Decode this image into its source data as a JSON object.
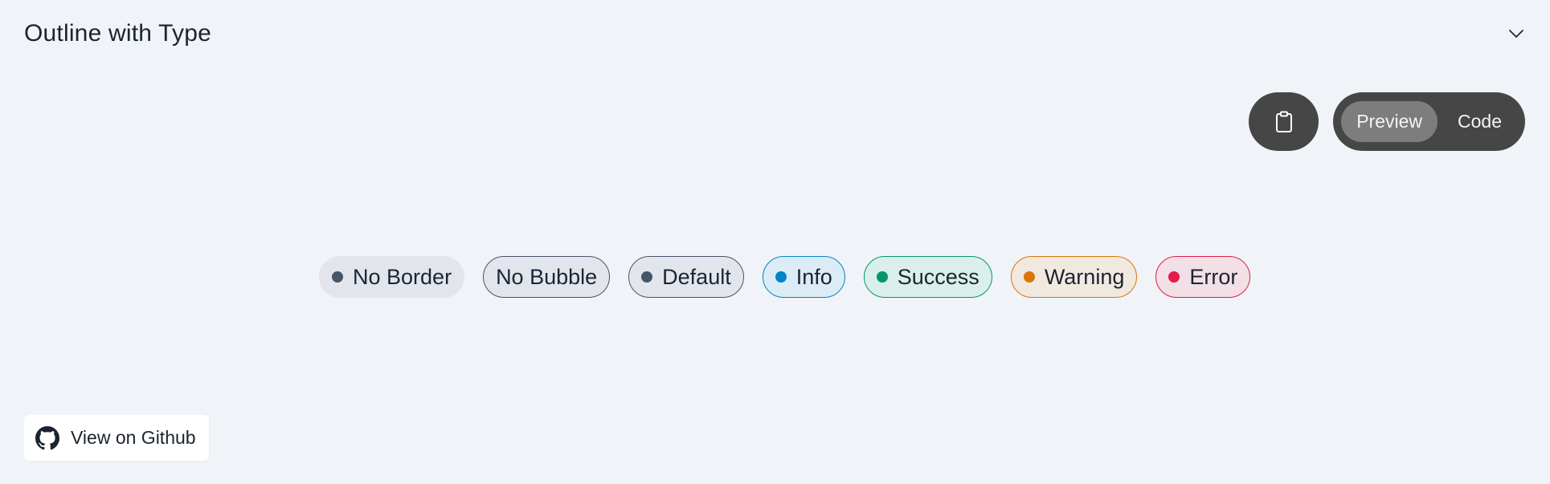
{
  "header": {
    "title": "Outline with Type"
  },
  "icons": {
    "collapse": "chevron-down-icon",
    "copy": "clipboard-icon",
    "github": "github-icon"
  },
  "toolbar": {
    "preview_label": "Preview",
    "code_label": "Code",
    "active": "Preview"
  },
  "badges": [
    {
      "label": "No Border",
      "dot": true,
      "dot_color": "#475569",
      "bg": "#e2e6ec",
      "border": "transparent"
    },
    {
      "label": "No Bubble",
      "dot": false,
      "dot_color": "",
      "bg": "#e2e6ec",
      "border": "#475569"
    },
    {
      "label": "Default",
      "dot": true,
      "dot_color": "#475569",
      "bg": "#e2e6ec",
      "border": "#475569"
    },
    {
      "label": "Info",
      "dot": true,
      "dot_color": "#0284c7",
      "bg": "#dcecf6",
      "border": "#0284c7"
    },
    {
      "label": "Success",
      "dot": true,
      "dot_color": "#059669",
      "bg": "#daefe9",
      "border": "#059669"
    },
    {
      "label": "Warning",
      "dot": true,
      "dot_color": "#d97706",
      "bg": "#f1e9e0",
      "border": "#d97706"
    },
    {
      "label": "Error",
      "dot": true,
      "dot_color": "#e11d48",
      "bg": "#f2e0e6",
      "border": "#e11d48"
    }
  ],
  "footer": {
    "github_label": "View on Github"
  }
}
